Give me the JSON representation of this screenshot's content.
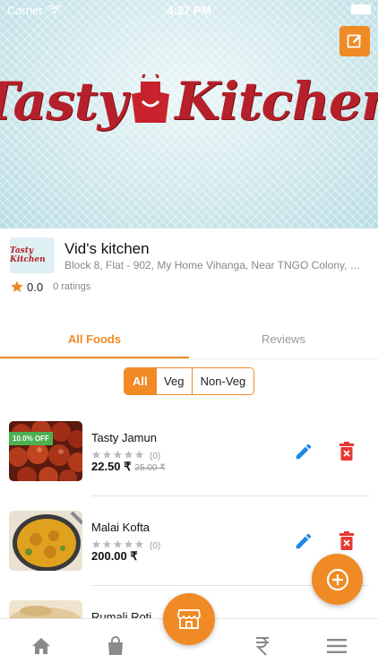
{
  "status_bar": {
    "carrier": "Carrier",
    "time": "4:27 PM"
  },
  "banner": {
    "logo_left": "Tasty",
    "logo_right": "Kitchen"
  },
  "kitchen": {
    "thumb_text": "Tasty Kitchen",
    "name": "Vid's kitchen",
    "address": "Block 8, Flat - 902, My Home Vihanga, Near TNGO Colony, …",
    "rating": "0.0",
    "rating_count": "0 ratings"
  },
  "tabs": [
    {
      "label": "All Foods",
      "active": true
    },
    {
      "label": "Reviews",
      "active": false
    }
  ],
  "filters": [
    {
      "label": "All",
      "active": true
    },
    {
      "label": "Veg",
      "active": false
    },
    {
      "label": "Non-Veg",
      "active": false
    }
  ],
  "foods": [
    {
      "name": "Tasty Jamun",
      "rating_count": "(0)",
      "price": "22.50 ₹",
      "old_price": "25.00 ₹",
      "badge": "10.0% OFF",
      "stars": 0
    },
    {
      "name": "Malai Kofta",
      "rating_count": "(0)",
      "price": "200.00 ₹",
      "old_price": "",
      "badge": "",
      "stars": 0
    },
    {
      "name": "Rumali Roti",
      "rating_count": "",
      "price": "",
      "old_price": "",
      "badge": "",
      "stars": 0
    }
  ],
  "colors": {
    "accent": "#f08a24",
    "delete": "#e53935",
    "edit": "#1e88e5",
    "badge": "#4caf50"
  },
  "icons": {
    "edit_banner": "edit-icon",
    "fab": "add-circle-icon",
    "nav": [
      "home-icon",
      "shopping-bag-icon",
      "store-icon",
      "rupee-icon",
      "menu-icon"
    ]
  }
}
